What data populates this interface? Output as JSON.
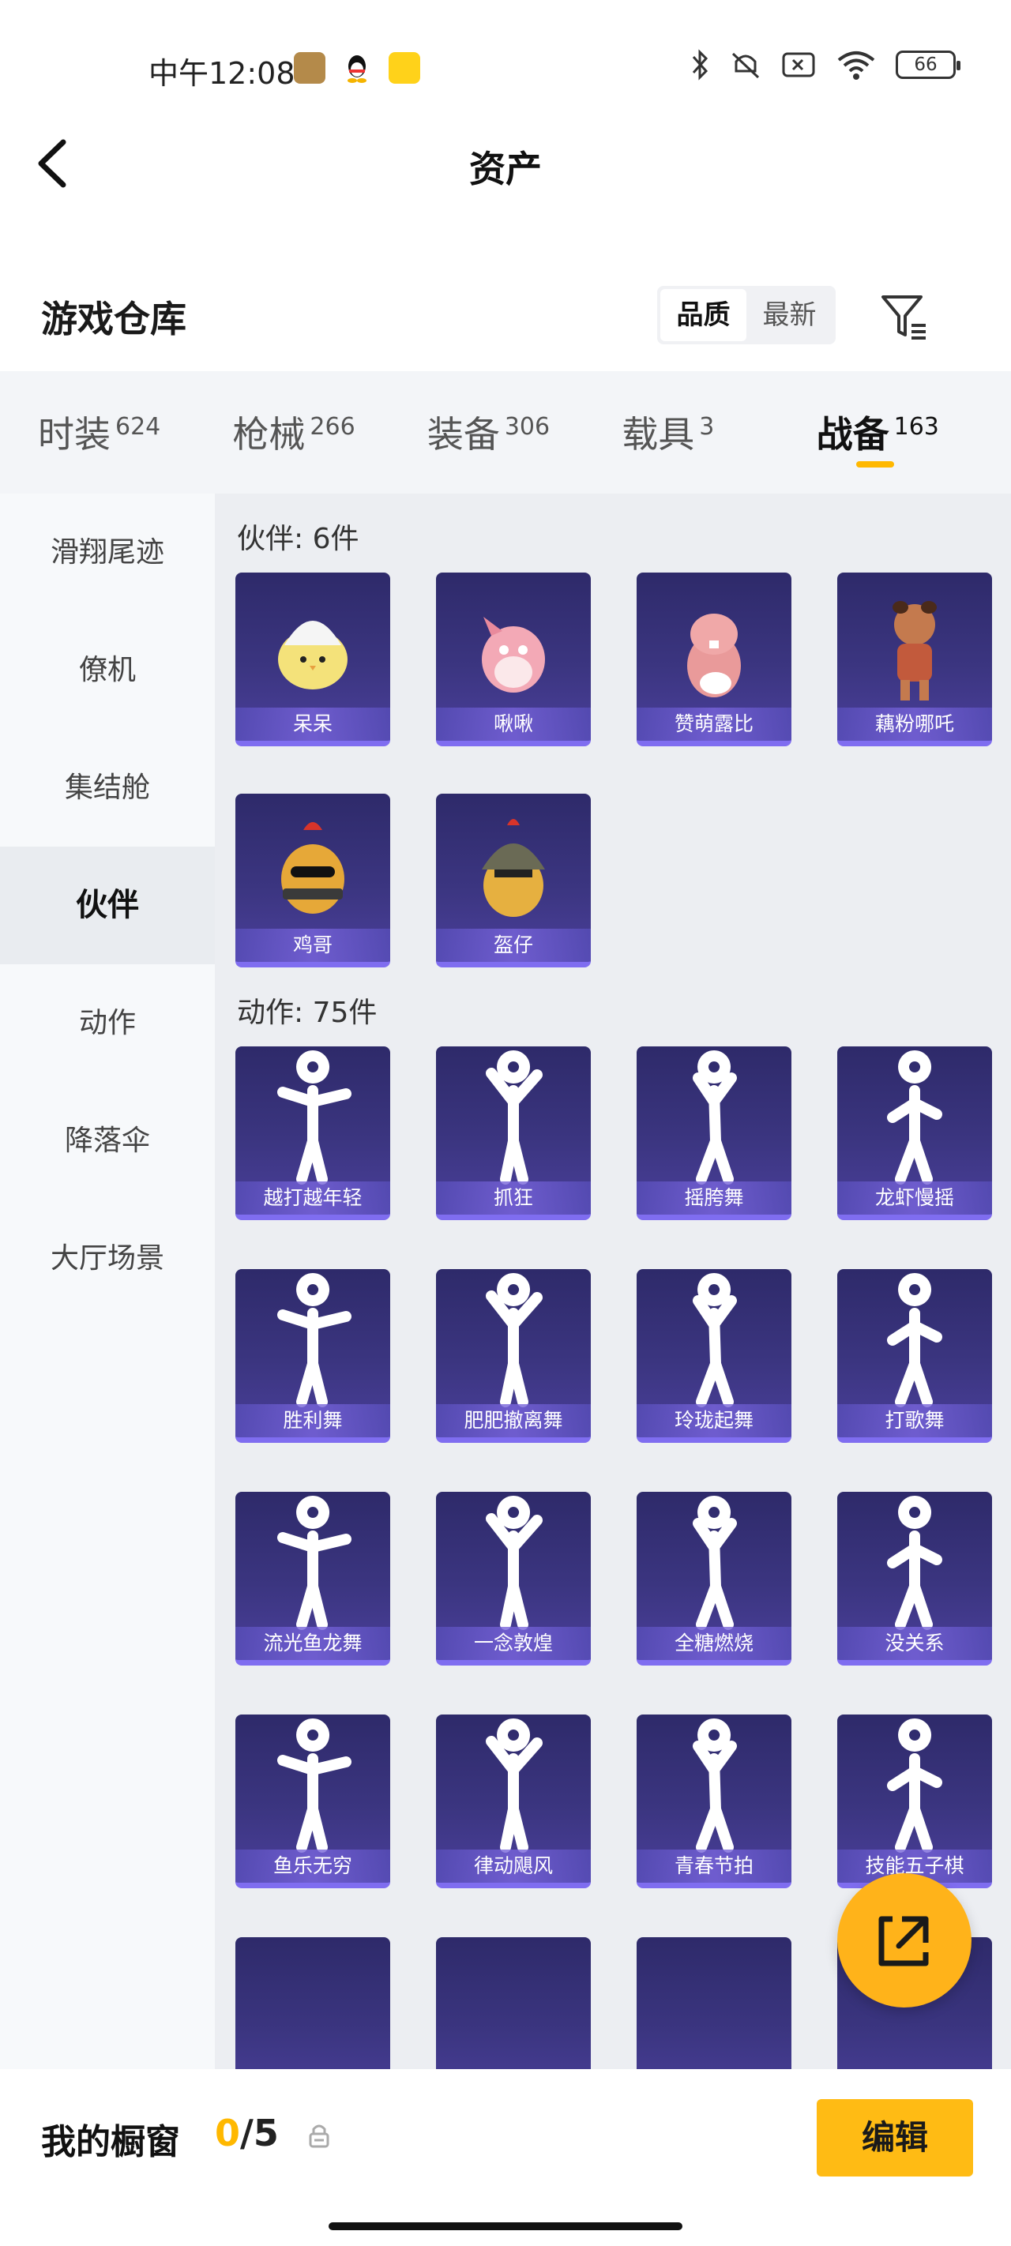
{
  "status_bar": {
    "time": "中午12:08",
    "battery": "66",
    "colors": {
      "app1": "#c08a3a",
      "app3": "#ffd21a"
    }
  },
  "header": {
    "title": "资产"
  },
  "warehouse": {
    "title": "游戏仓库",
    "sort_options": [
      "品质",
      "最新"
    ],
    "selected_sort": "品质"
  },
  "categories": [
    {
      "label": "时装",
      "count": "624"
    },
    {
      "label": "枪械",
      "count": "266"
    },
    {
      "label": "装备",
      "count": "306"
    },
    {
      "label": "载具",
      "count": "3"
    },
    {
      "label": "战备",
      "count": "163"
    }
  ],
  "active_category": "战备",
  "sidebar": {
    "items": [
      "滑翔尾迹",
      "僚机",
      "集结舱",
      "伙伴",
      "动作",
      "降落伞",
      "大厅场景"
    ],
    "active": "伙伴"
  },
  "sections": {
    "partners": {
      "title": "伙伴: 6件",
      "items": [
        "呆呆",
        "啾啾",
        "赞萌露比",
        "藕粉哪吒",
        "鸡哥",
        "盔仔"
      ]
    },
    "emotes": {
      "title": "动作: 75件",
      "items": [
        "越打越年轻",
        "抓狂",
        "摇胯舞",
        "龙虾慢摇",
        "胜利舞",
        "肥肥撤离舞",
        "玲珑起舞",
        "打歌舞",
        "流光鱼龙舞",
        "一念敦煌",
        "全糖燃烧",
        "没关系",
        "鱼乐无穷",
        "律动飓风",
        "青春节拍",
        "技能五子棋"
      ]
    }
  },
  "bottom": {
    "showcase_label": "我的橱窗",
    "current": "0",
    "total": "/5",
    "edit_label": "编辑"
  },
  "theme": {
    "accent": "#ffb800",
    "tile_bg": "#3b3580"
  }
}
